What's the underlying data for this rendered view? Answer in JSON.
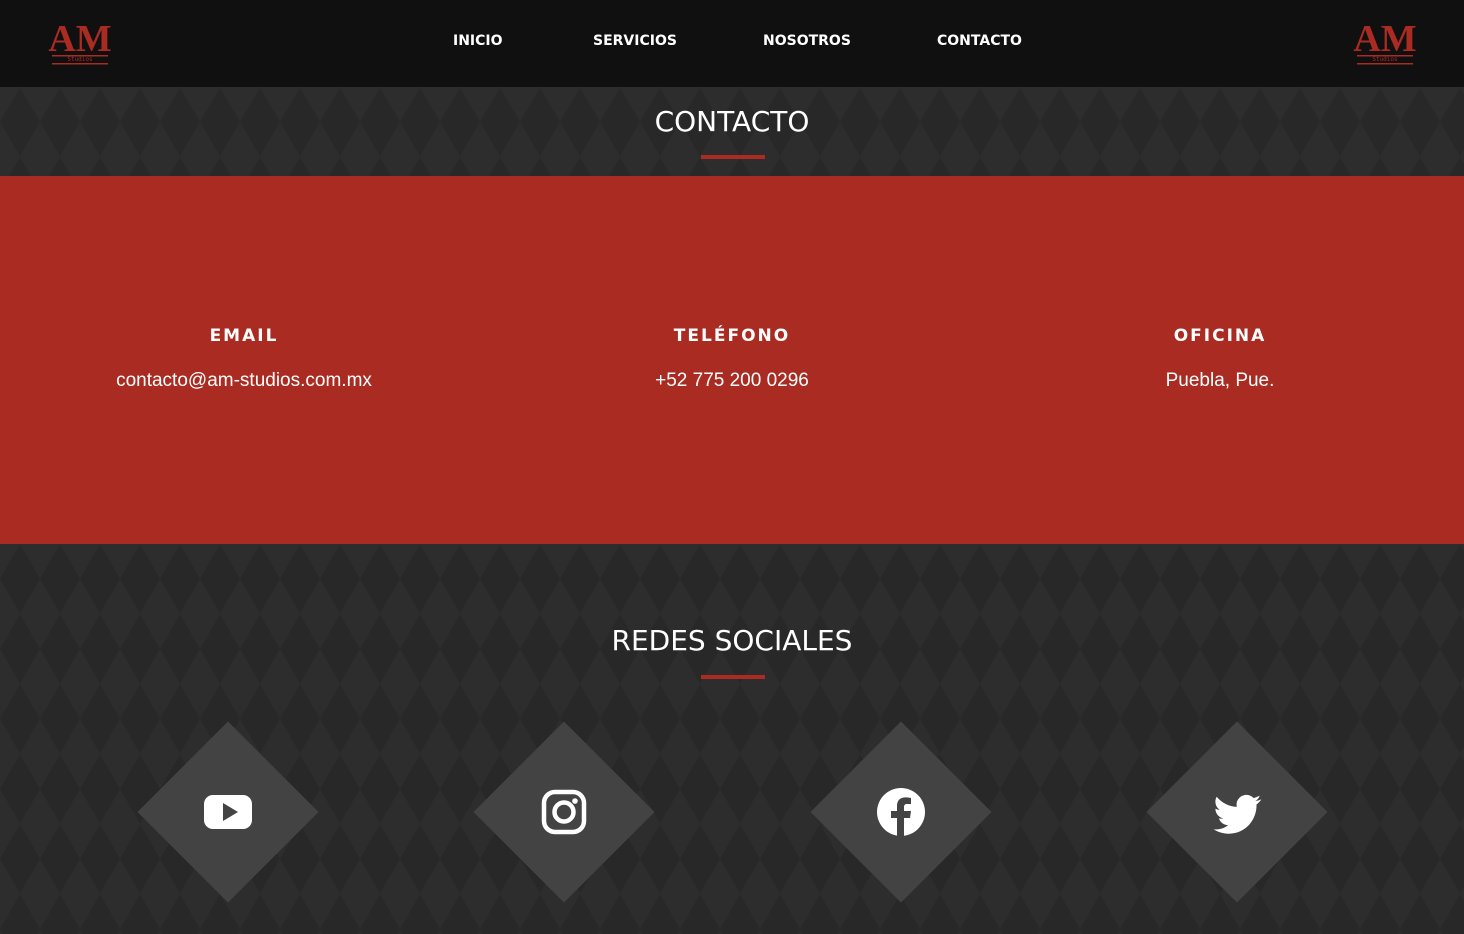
{
  "header": {
    "logo_text": "AM",
    "logo_subtext": "Studios",
    "nav": [
      {
        "label": "INICIO"
      },
      {
        "label": "SERVICIOS"
      },
      {
        "label": "NOSOTROS"
      },
      {
        "label": "CONTACTO"
      }
    ]
  },
  "contact_section": {
    "title": "CONTACTO",
    "items": [
      {
        "label": "EMAIL",
        "value": "contacto@am-studios.com.mx"
      },
      {
        "label": "TELÉFONO",
        "value": "+52 775 200 0296"
      },
      {
        "label": "OFICINA",
        "value": "Puebla, Pue."
      }
    ]
  },
  "social_section": {
    "title": "REDES SOCIALES",
    "networks": [
      {
        "icon": "youtube-icon"
      },
      {
        "icon": "instagram-icon"
      },
      {
        "icon": "facebook-icon"
      },
      {
        "icon": "twitter-icon"
      }
    ]
  },
  "colors": {
    "accent": "#a92b22",
    "header_bg": "#101010",
    "page_bg": "#282828",
    "diamond": "#444344"
  }
}
